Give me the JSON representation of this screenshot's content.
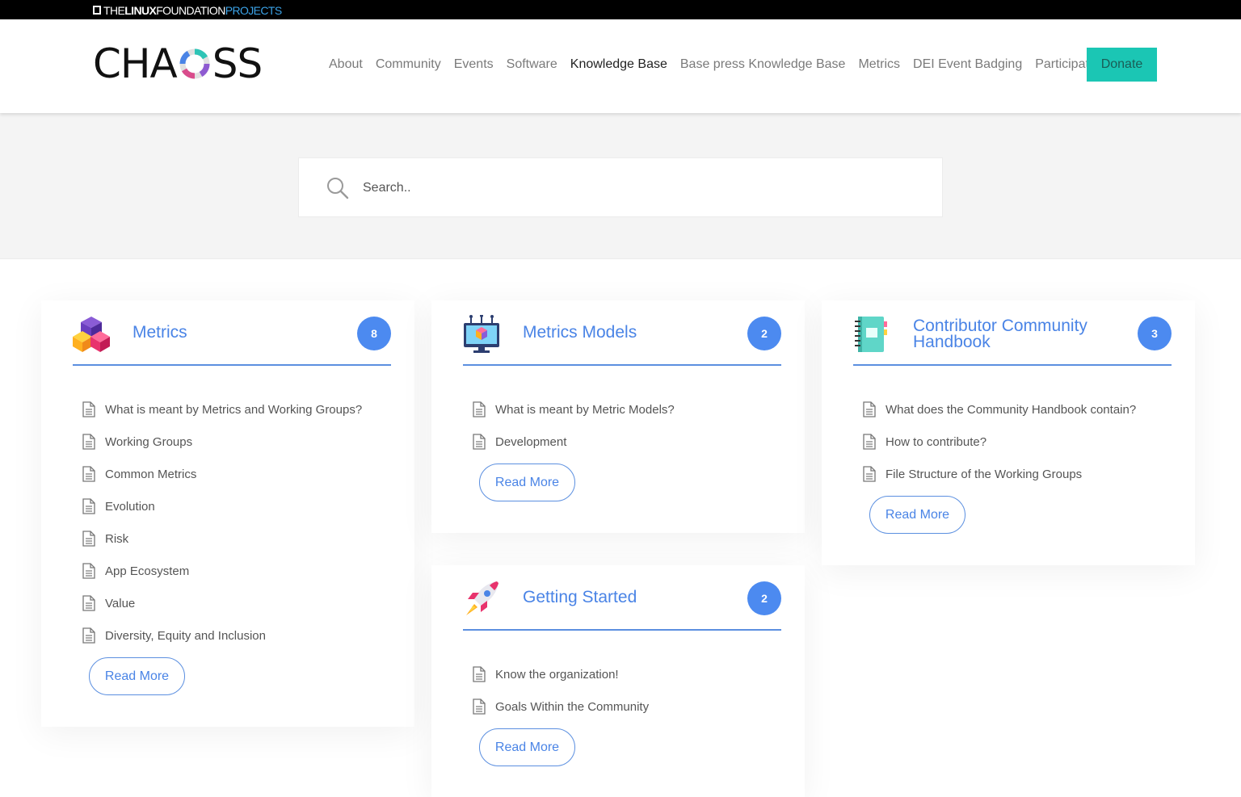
{
  "top_bar": {
    "the": "THE",
    "linux": "LINUX",
    "foundation": "FOUNDATION",
    "projects": "PROJECTS"
  },
  "logo": {
    "left": "CHA",
    "right": "SS"
  },
  "nav": {
    "items": [
      "About",
      "Community",
      "Events",
      "Software",
      "Knowledge Base",
      "Base press Knowledge Base",
      "Metrics",
      "DEI Event Badging",
      "Participate"
    ],
    "active_index": 4,
    "donate": "Donate"
  },
  "search": {
    "placeholder": "Search.."
  },
  "colors": {
    "accent": "#4a84e6",
    "donate": "#1bc6b4",
    "count_badge": "#4c8af0"
  },
  "cards": [
    {
      "title": "Metrics",
      "icon": "cubes-icon",
      "count": "8",
      "links": [
        "What is meant by Metrics and Working Groups?",
        "Working Groups",
        "Common Metrics",
        "Evolution",
        "Risk",
        "App Ecosystem",
        "Value",
        "Diversity, Equity and Inclusion"
      ],
      "read_more": "Read More"
    },
    {
      "title": "Metrics Models",
      "icon": "monitor-icon",
      "count": "2",
      "links": [
        "What is meant by Metric Models?",
        "Development"
      ],
      "read_more": "Read More"
    },
    {
      "title_line1": "Contributor Community",
      "title_line2": "Handbook",
      "icon": "notebook-icon",
      "count": "3",
      "links": [
        "What does the Community Handbook contain?",
        "How to contribute?",
        "File Structure of the Working Groups"
      ],
      "read_more": "Read More"
    },
    {
      "title": "Getting Started",
      "icon": "rocket-icon",
      "count": "2",
      "links": [
        "Know the organization!",
        "Goals Within the Community"
      ],
      "read_more": "Read More"
    }
  ]
}
